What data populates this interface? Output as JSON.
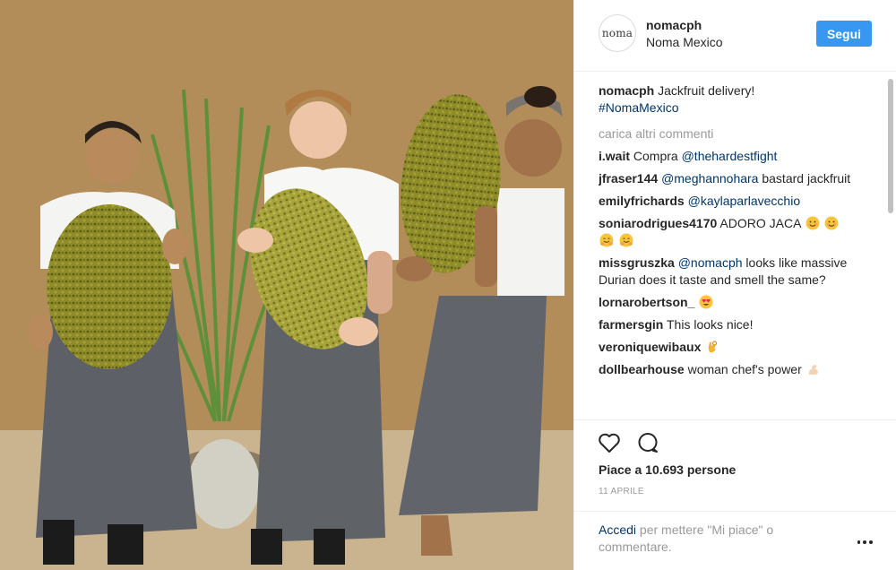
{
  "post": {
    "image_alt": "Three cooks holding jackfruits in front of a bamboo fence",
    "header": {
      "avatar_text": "noma",
      "username": "nomacph",
      "location": "Noma Mexico",
      "follow_label": "Segui"
    },
    "caption": {
      "username": "nomacph",
      "text": "Jackfruit delivery!",
      "hashtag": "#NomaMexico"
    },
    "load_more_label": "carica altri commenti",
    "comments": [
      {
        "username": "i.wait",
        "text": "Compra ",
        "mention": "@thehardestfight",
        "after": ""
      },
      {
        "username": "jfraser144",
        "text": "",
        "mention": "@meghannohara",
        "after": " bastard jackfruit"
      },
      {
        "username": "emilyfrichards",
        "text": "",
        "mention": "@kaylaparlavecchio",
        "after": ""
      },
      {
        "username": "soniarodrigues4170",
        "text": "ADORO JACA",
        "mention": "",
        "after": "",
        "emojis": [
          "smile",
          "smile",
          "hug",
          "hug"
        ]
      },
      {
        "username": "missgruszka",
        "text": "",
        "mention": "@nomacph",
        "after": " looks like massive Durian does it taste and smell the same?"
      },
      {
        "username": "lornarobertson_",
        "text": "",
        "mention": "",
        "after": "",
        "emojis": [
          "heart-eyes"
        ]
      },
      {
        "username": "farmersgin",
        "text": "This looks nice!",
        "mention": "",
        "after": ""
      },
      {
        "username": "veroniquewibaux",
        "text": "",
        "mention": "",
        "after": "",
        "emojis": [
          "ok-hand"
        ]
      },
      {
        "username": "dollbearhouse",
        "text": "woman chef's power",
        "mention": "",
        "after": "",
        "emojis": [
          "flexed-arm"
        ]
      }
    ],
    "likes_text": "Piace a 10.693 persone",
    "date_text": "11 APRILE",
    "login_link": "Accedi",
    "login_rest": " per mettere \"Mi piace\" o commentare.",
    "icons": {
      "like": "heart-outline-icon",
      "comment": "comment-bubble-icon",
      "more": "more-options-icon"
    },
    "colors": {
      "follow_button": "#3897f0",
      "link": "#003569",
      "muted": "#999999"
    }
  }
}
